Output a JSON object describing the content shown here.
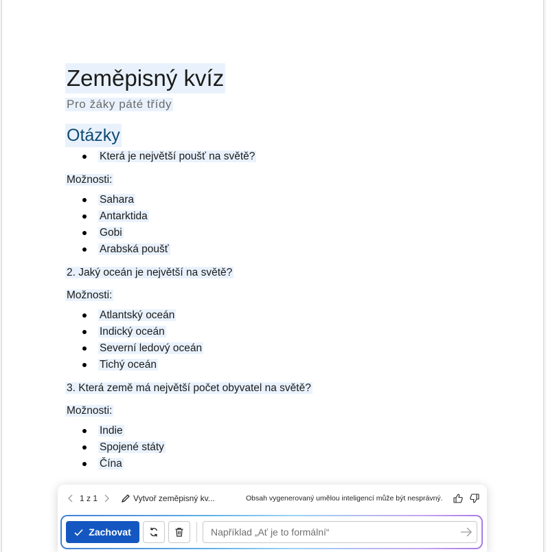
{
  "document": {
    "title": "Zeměpisný kvíz",
    "subtitle": "Pro žáky páté třídy",
    "heading": "Otázky",
    "q1": "Která je největší poušť na světě?",
    "options_label": "Možnosti:",
    "q1_options": [
      "Sahara",
      "Antarktida",
      "Gobi",
      "Arabská poušť"
    ],
    "q2": "2. Jaký oceán je největší na světě?",
    "q2_options": [
      "Atlantský oceán",
      "Indický oceán",
      "Severní ledový oceán",
      "Tichý oceán"
    ],
    "q3": "3. Která země má největší počet obyvatel na světě?",
    "q3_options": [
      "Indie",
      "Spojené státy",
      "Čína"
    ]
  },
  "copilot": {
    "pager": "1 z 1",
    "prompt_text": "Vytvoř zeměpisný kv...",
    "disclaimer": "Obsah vygenerovaný umělou inteligencí může být nesprávný.",
    "keep_label": "Zachovat",
    "input_placeholder": "Například „Ať je to formální“",
    "accent_color": "#1557c0"
  }
}
